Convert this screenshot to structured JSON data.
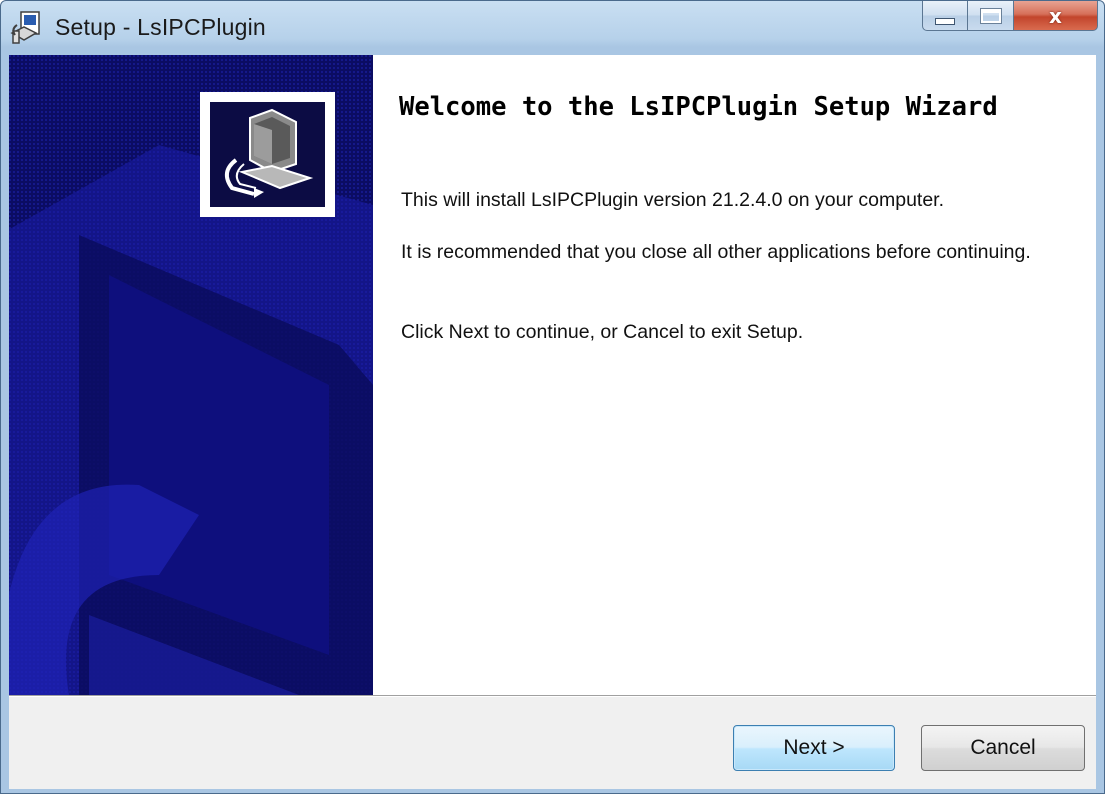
{
  "window": {
    "title": "Setup - LsIPCPlugin",
    "controls": {
      "minimize": "minimize-icon",
      "maximize": "maximize-icon",
      "close_symbol": "x"
    }
  },
  "wizard": {
    "heading": "Welcome to the LsIPCPlugin Setup Wizard",
    "paragraphs": [
      "This will install LsIPCPlugin version 21.2.4.0 on your computer.",
      "It is recommended that you close all other applications before continuing.",
      "Click Next to continue, or Cancel to exit Setup."
    ]
  },
  "buttons": {
    "next": "Next >",
    "cancel": "Cancel"
  },
  "colors": {
    "side_panel": "#0b0c63",
    "title_bar": "#b6d1ea",
    "default_button_border": "#3c7fb1"
  }
}
